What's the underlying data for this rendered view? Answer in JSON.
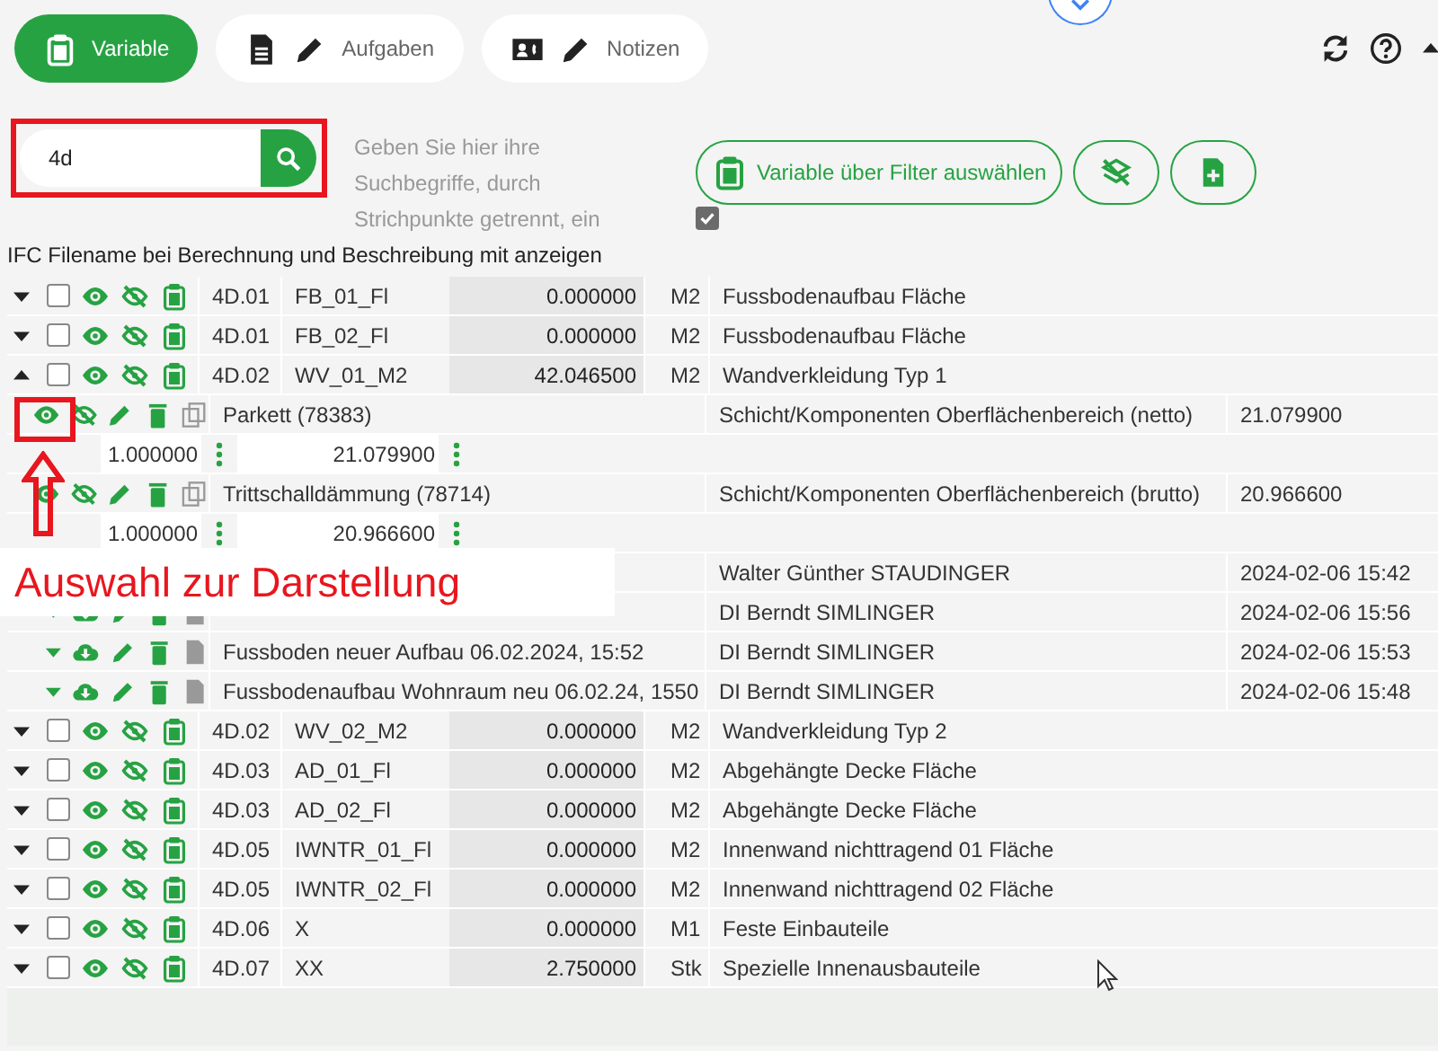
{
  "tabs": [
    {
      "label": "Variable",
      "selected": true
    },
    {
      "label": "Aufgaben",
      "selected": false
    },
    {
      "label": "Notizen",
      "selected": false
    }
  ],
  "search": {
    "value": "4d"
  },
  "search_hint": "Geben Sie hier ihre Suchbegriffe, durch Strichpunkte getrennt, ein",
  "filter_button": "Variable über Filter auswählen",
  "filter_checkbox": {
    "checked": true
  },
  "ifc_option": "IFC Filename bei Berechnung und Beschreibung mit anzeigen",
  "rows": [
    {
      "kind": "variable",
      "expanded": false,
      "checked": false,
      "code": "4D.01",
      "name": "FB_01_Fl",
      "value": "0.000000",
      "unit": "M2",
      "description": "Fussbodenaufbau Fläche"
    },
    {
      "kind": "variable",
      "expanded": false,
      "checked": false,
      "code": "4D.01",
      "name": "FB_02_Fl",
      "value": "0.000000",
      "unit": "M2",
      "description": "Fussbodenaufbau Fläche"
    },
    {
      "kind": "variable",
      "expanded": true,
      "checked": false,
      "code": "4D.02",
      "name": "WV_01_M2",
      "value": "42.046500",
      "unit": "M2",
      "description": "Wandverkleidung Typ 1"
    },
    {
      "kind": "component",
      "name": "Parkett (78383)",
      "description": "Schicht/Komponenten Oberflächenbereich (netto)",
      "value": "21.079900"
    },
    {
      "kind": "amount",
      "factor": "1.000000",
      "value": "21.079900"
    },
    {
      "kind": "component",
      "name": "Trittschalldämmung (78714)",
      "description": "Schicht/Komponenten Oberflächenbereich (brutto)",
      "value": "20.966600"
    },
    {
      "kind": "amount",
      "factor": "1.000000",
      "value": "20.966600"
    },
    {
      "kind": "covered_task",
      "author": "Walter Günther STAUDINGER",
      "date": "2024-02-06 15:42"
    },
    {
      "kind": "task",
      "author": "DI Berndt SIMLINGER",
      "date": "2024-02-06 15:56"
    },
    {
      "kind": "task",
      "title": "Fussboden neuer Aufbau 06.02.2024, 15:52",
      "author": "DI Berndt SIMLINGER",
      "date": "2024-02-06 15:53"
    },
    {
      "kind": "task",
      "title": "Fussbodenaufbau Wohnraum neu 06.02.24, 1550",
      "author": "DI Berndt SIMLINGER",
      "date": "2024-02-06 15:48"
    },
    {
      "kind": "variable",
      "expanded": false,
      "checked": false,
      "code": "4D.02",
      "name": "WV_02_M2",
      "value": "0.000000",
      "unit": "M2",
      "description": "Wandverkleidung Typ 2"
    },
    {
      "kind": "variable",
      "expanded": false,
      "checked": false,
      "code": "4D.03",
      "name": "AD_01_Fl",
      "value": "0.000000",
      "unit": "M2",
      "description": "Abgehängte Decke Fläche"
    },
    {
      "kind": "variable",
      "expanded": false,
      "checked": false,
      "code": "4D.03",
      "name": "AD_02_Fl",
      "value": "0.000000",
      "unit": "M2",
      "description": "Abgehängte Decke Fläche"
    },
    {
      "kind": "variable",
      "expanded": false,
      "checked": false,
      "code": "4D.05",
      "name": "IWNTR_01_Fl",
      "value": "0.000000",
      "unit": "M2",
      "description": "Innenwand nichttragend 01 Fläche"
    },
    {
      "kind": "variable",
      "expanded": false,
      "checked": false,
      "code": "4D.05",
      "name": "IWNTR_02_Fl",
      "value": "0.000000",
      "unit": "M2",
      "description": "Innenwand nichttragend 02 Fläche"
    },
    {
      "kind": "variable",
      "expanded": false,
      "checked": false,
      "code": "4D.06",
      "name": "X",
      "value": "0.000000",
      "unit": "M1",
      "description": "Feste Einbauteile"
    },
    {
      "kind": "variable",
      "expanded": false,
      "checked": false,
      "code": "4D.07",
      "name": "XX",
      "value": "2.750000",
      "unit": "Stk",
      "description": "Spezielle Innenausbauteile"
    }
  ],
  "annotation": {
    "label": "Auswahl zur Darstellung"
  }
}
